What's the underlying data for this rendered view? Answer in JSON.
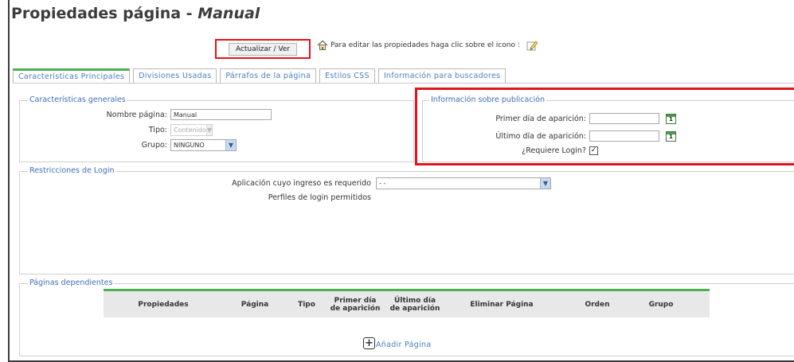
{
  "page": {
    "title_prefix": "Propiedades página - ",
    "title_name": "Manual"
  },
  "toolbar": {
    "update_label": "Actualizar / Ver",
    "hint_text": "Para editar las propiedades haga clic sobre el icono :"
  },
  "tabs": [
    {
      "label": "Características Principales",
      "active": true
    },
    {
      "label": "Divisiones Usadas",
      "active": false
    },
    {
      "label": "Párrafos de la página",
      "active": false
    },
    {
      "label": "Estilos CSS",
      "active": false
    },
    {
      "label": "Información para buscadores",
      "active": false
    }
  ],
  "general": {
    "legend": "Características generales",
    "name_label": "Nombre página:",
    "name_value": "Manual",
    "type_label": "Tipo:",
    "type_value": "Contenido",
    "group_label": "Grupo:",
    "group_value": "NINGUNO"
  },
  "publication": {
    "legend": "Información sobre publicación",
    "first_day_label": "Primer día de aparición:",
    "first_day_value": "",
    "last_day_label": "Último día de aparición:",
    "last_day_value": "",
    "login_label": "¿Requiere Login?",
    "login_checked": true
  },
  "login": {
    "legend": "Restricciones de Login",
    "app_label": "Aplicación cuyo ingreso es requerido",
    "app_value": "- -",
    "profiles_label": "Perfiles de login permitidos"
  },
  "dependents": {
    "legend": "Páginas dependientes",
    "columns": [
      "Propiedades",
      "Página",
      "Tipo",
      "Primer día de aparición",
      "Último día de aparición",
      "Eliminar Página",
      "Orden",
      "Grupo"
    ],
    "column_lines": [
      [
        "Propiedades"
      ],
      [
        "Página"
      ],
      [
        "Tipo"
      ],
      [
        "Primer día",
        "de aparición"
      ],
      [
        "Último día",
        "de aparición"
      ],
      [
        "Eliminar Página"
      ],
      [
        "Orden"
      ],
      [
        "Grupo"
      ]
    ],
    "add_label": "Añadir Página"
  },
  "colors": {
    "accent_green": "#4caf50",
    "link_blue": "#4a7fc0",
    "highlight_red": "#e0141e"
  },
  "icons": [
    "home-icon",
    "edit-icon",
    "calendar-icon",
    "dropdown-arrow-icon",
    "checkbox-icon",
    "add-icon"
  ]
}
